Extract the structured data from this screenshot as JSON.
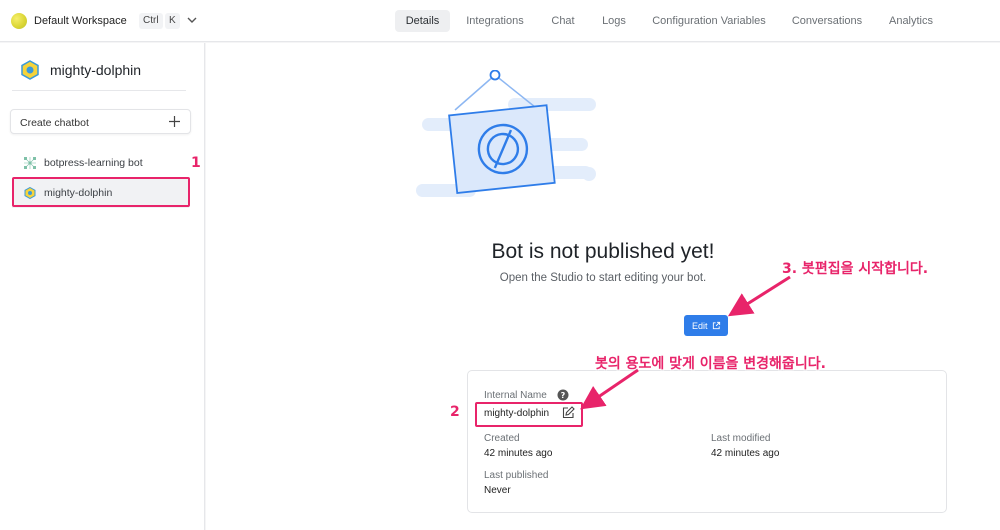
{
  "workspace": {
    "name": "Default Workspace",
    "shortcut_ctrl": "Ctrl",
    "shortcut_key": "K"
  },
  "tabs": [
    {
      "label": "Details",
      "active": true
    },
    {
      "label": "Integrations",
      "active": false
    },
    {
      "label": "Chat",
      "active": false
    },
    {
      "label": "Logs",
      "active": false
    },
    {
      "label": "Configuration Variables",
      "active": false
    },
    {
      "label": "Conversations",
      "active": false
    },
    {
      "label": "Analytics",
      "active": false
    }
  ],
  "sidebar": {
    "bot_title": "mighty-dolphin",
    "create_label": "Create chatbot",
    "bots": [
      {
        "label": "botpress-learning bot",
        "icon": "grid-icon"
      },
      {
        "label": "mighty-dolphin",
        "icon": "hexagon-icon",
        "selected": true
      }
    ]
  },
  "main": {
    "headline": "Bot is not published yet!",
    "subline": "Open the Studio to start editing your bot.",
    "edit_label": "Edit"
  },
  "details": {
    "internal_name_label": "Internal Name",
    "internal_name_value": "mighty-dolphin",
    "created_label": "Created",
    "created_value": "42 minutes ago",
    "modified_label": "Last modified",
    "modified_value": "42 minutes ago",
    "published_label": "Last published",
    "published_value": "Never"
  },
  "annotations": {
    "n1": "1",
    "n2": "2",
    "n3_text": "3. 봇편집을 시작합니다.",
    "rename_text": "봇의 용도에 맞게 이름을 변경해줍니다."
  },
  "colors": {
    "accent": "#2f7de9",
    "annotation": "#e8246a",
    "illustration": "#2f7de9"
  }
}
